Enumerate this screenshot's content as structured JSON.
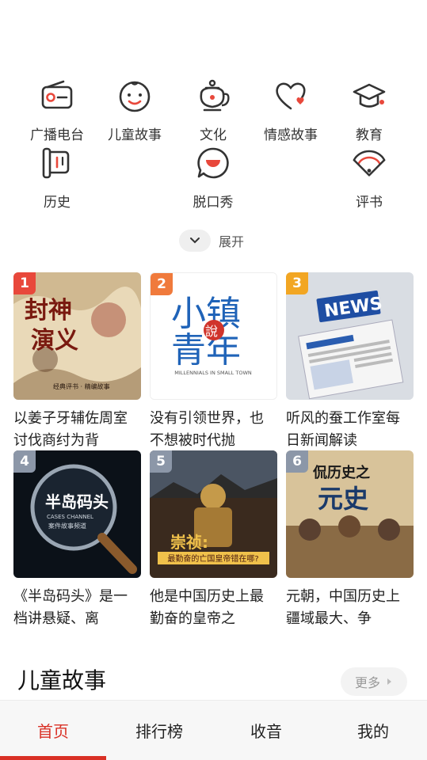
{
  "categories": [
    {
      "label": "广播电台",
      "icon": "radio-icon"
    },
    {
      "label": "儿童故事",
      "icon": "baby-face-icon"
    },
    {
      "label": "文化",
      "icon": "teapot-icon"
    },
    {
      "label": "情感故事",
      "icon": "heart-icon"
    },
    {
      "label": "教育",
      "icon": "graduation-cap-icon"
    },
    {
      "label": "历史",
      "icon": "scroll-icon"
    },
    {
      "label": "脱口秀",
      "icon": "speech-bubble-icon"
    },
    {
      "label": "评书",
      "icon": "fan-icon"
    }
  ],
  "expand": {
    "label": "展开",
    "icon": "chevron-down-icon"
  },
  "cards": [
    {
      "rank": "1",
      "rank_color": "#e8483b",
      "cover_title": "封神演义",
      "cover_sub": "经典评书 · 精编故事",
      "desc": "以姜子牙辅佐周室讨伐商纣为背"
    },
    {
      "rank": "2",
      "rank_color": "#f07a3c",
      "cover_title_a": "小镇",
      "cover_stamp": "說",
      "cover_title_b": "青年",
      "cover_sub": "MILLENNIALS IN SMALL TOWN",
      "desc": "没有引领世界，也不想被时代抛"
    },
    {
      "rank": "3",
      "rank_color": "#f2a623",
      "cover_title": "NEWS",
      "desc": "听风的蚕工作室每日新闻解读"
    },
    {
      "rank": "4",
      "rank_color": "#8c97a8",
      "cover_title": "半岛码头",
      "cover_sub": "CASES CHANNEL",
      "cover_sub2": "案件故事频道",
      "desc": "《半岛码头》是一档讲悬疑、离"
    },
    {
      "rank": "5",
      "rank_color": "#8c97a8",
      "cover_title": "崇祯:",
      "cover_sub": "最勤奋的亡国皇帝错在哪?",
      "desc": "他是中国历史上最勤奋的皇帝之"
    },
    {
      "rank": "6",
      "rank_color": "#8c97a8",
      "cover_title_a": "侃历史之",
      "cover_title_b": "元史",
      "desc": "元朝，中国历史上疆域最大、争"
    }
  ],
  "section": {
    "title": "儿童故事",
    "more_label": "更多"
  },
  "tabs": [
    {
      "label": "首页",
      "active": true
    },
    {
      "label": "排行榜",
      "active": false
    },
    {
      "label": "收音",
      "active": false
    },
    {
      "label": "我的",
      "active": false
    }
  ],
  "colors": {
    "accent": "#d93025"
  }
}
